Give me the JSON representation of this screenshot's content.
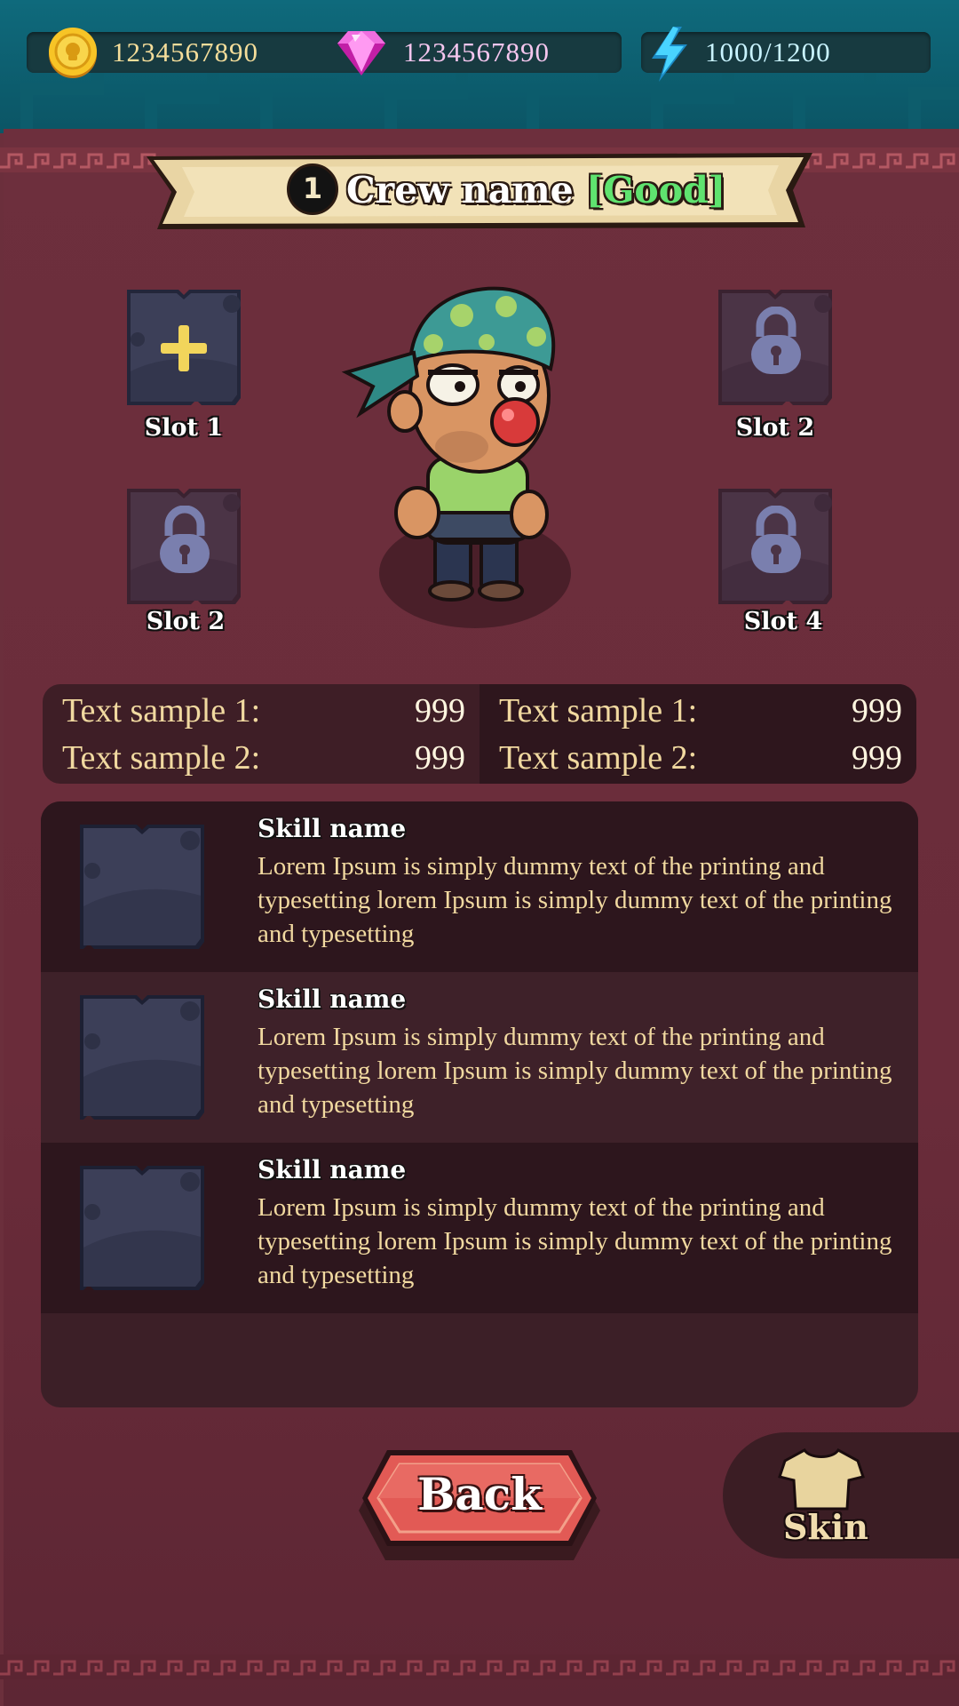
{
  "resources": {
    "gold": {
      "icon": "gold-coin-icon",
      "value": "1234567890",
      "color": "#f4dd9a"
    },
    "gems": {
      "icon": "pink-gem-icon",
      "value": "1234567890",
      "color": "#f4c6ee"
    },
    "energy": {
      "icon": "lightning-bolt-icon",
      "value": "1000/1200",
      "color": "#c9f4ff"
    }
  },
  "header": {
    "rank": "1",
    "crew_name": "Crew name",
    "quality": "[Good]",
    "quality_color": "#5fe36f"
  },
  "slots": [
    {
      "label": "Slot 1",
      "state": "add",
      "icon": "plus-icon"
    },
    {
      "label": "Slot 2",
      "state": "locked",
      "icon": "lock-icon"
    },
    {
      "label": "Slot 2",
      "state": "locked",
      "icon": "lock-icon"
    },
    {
      "label": "Slot 4",
      "state": "locked",
      "icon": "lock-icon"
    }
  ],
  "stats": {
    "left": [
      {
        "label": "Text sample 1:",
        "value": "999"
      },
      {
        "label": "Text sample 2:",
        "value": "999"
      }
    ],
    "right": [
      {
        "label": "Text sample 1:",
        "value": "999"
      },
      {
        "label": "Text sample 2:",
        "value": "999"
      }
    ]
  },
  "skills": [
    {
      "name": "Skill name",
      "description": "Lorem Ipsum is simply dummy text of the printing and typesetting lorem Ipsum is simply dummy text of the printing and typesetting"
    },
    {
      "name": "Skill name",
      "description": "Lorem Ipsum is simply dummy text of the printing and typesetting lorem Ipsum is simply dummy text of the printing and typesetting"
    },
    {
      "name": "Skill name",
      "description": "Lorem Ipsum is simply dummy text of the printing and typesetting lorem Ipsum is simply dummy text of the printing and typesetting"
    }
  ],
  "buttons": {
    "back_label": "Back",
    "skin_label": "Skin",
    "skin_icon": "tshirt-icon"
  },
  "colors": {
    "panel": "#6b2f3c",
    "topbar": "#0f6a7c",
    "slot_bg": "#3c3f58",
    "lock": "#7a7fae",
    "plus": "#f2d55b",
    "back_button": "#d84b4b"
  }
}
